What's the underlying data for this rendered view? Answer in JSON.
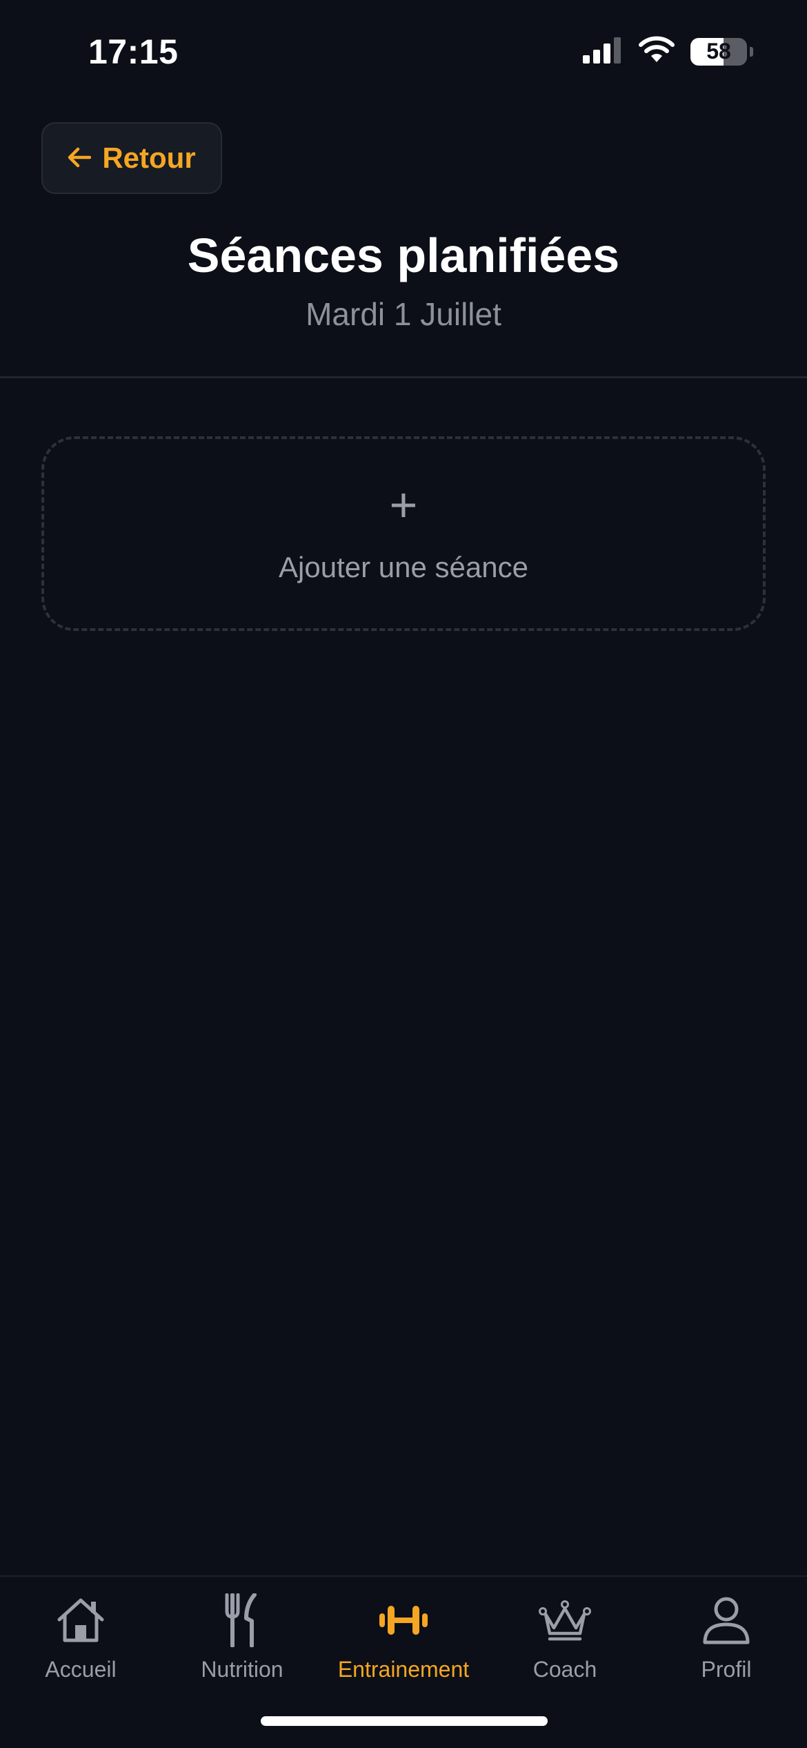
{
  "status_bar": {
    "time": "17:15",
    "battery_level": "58",
    "battery_fraction": 0.58
  },
  "header": {
    "back_label": "Retour",
    "title": "Séances planifiées",
    "subtitle": "Mardi 1 Juillet"
  },
  "add_session": {
    "plus": "+",
    "label": "Ajouter une séance"
  },
  "tab_bar": {
    "items": [
      {
        "label": "Accueil",
        "icon": "home-icon",
        "active": false
      },
      {
        "label": "Nutrition",
        "icon": "fork-knife-icon",
        "active": false
      },
      {
        "label": "Entrainement",
        "icon": "dumbbell-icon",
        "active": true
      },
      {
        "label": "Coach",
        "icon": "crown-icon",
        "active": false
      },
      {
        "label": "Profil",
        "icon": "user-icon",
        "active": false
      }
    ]
  },
  "colors": {
    "background": "#0c0f17",
    "accent": "#f5a623",
    "muted": "#9a9ea8"
  }
}
